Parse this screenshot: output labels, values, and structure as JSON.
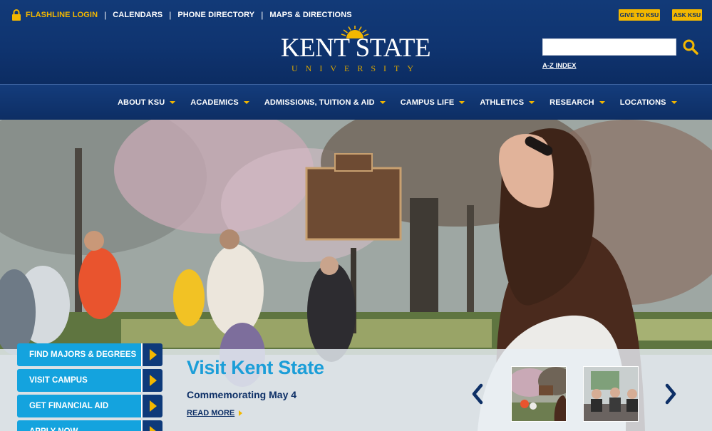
{
  "utility_nav": {
    "login": "FLASHLINE LOGIN",
    "links": [
      "CALENDARS",
      "PHONE DIRECTORY",
      "MAPS & DIRECTIONS"
    ],
    "separator": "|"
  },
  "header_buttons": {
    "give": "GIVE TO KSU",
    "ask": "ASK KSU"
  },
  "logo": {
    "wordmark": "KENT STATE",
    "subline": "UNIVERSITY"
  },
  "search": {
    "placeholder": "",
    "az_index": "A-Z INDEX"
  },
  "main_nav": [
    "ABOUT KSU",
    "ACADEMICS",
    "ADMISSIONS, TUITION & AID",
    "CAMPUS LIFE",
    "ATHLETICS",
    "RESEARCH",
    "LOCATIONS"
  ],
  "quick_links": [
    "FIND MAJORS & DEGREES",
    "VISIT CAMPUS",
    "GET FINANCIAL AID",
    "APPLY NOW"
  ],
  "feature": {
    "title": "Visit Kent State",
    "subtitle": "Commemorating May 4",
    "read_more": "READ MORE"
  },
  "colors": {
    "navy": "#0d2f66",
    "gold": "#f3b700",
    "light_blue": "#14a3de"
  },
  "icons": {
    "lock": "lock-icon",
    "search": "search-icon",
    "sun": "sun-icon"
  }
}
